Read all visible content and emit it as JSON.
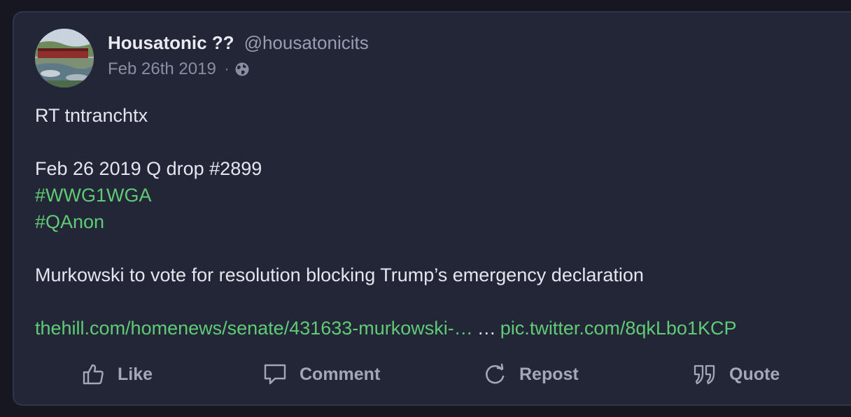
{
  "post": {
    "display_name": "Housatonic ??",
    "handle": "@housatonicits",
    "date": "Feb 26th 2019",
    "separator": "·",
    "visibility_icon": "globe-icon",
    "body": {
      "line1": "RT tntranchtx",
      "line2": "Feb 26 2019 Q drop #2899",
      "hashtag1": "#WWG1WGA",
      "hashtag2": "#QAnon",
      "line3": "Murkowski to vote for resolution blocking Trump’s emergency declaration",
      "link1": "thehill.com/homenews/senate/431633-murkowski-…",
      "ellipsis": "…",
      "link2": "pic.twitter.com/8qkLbo1KCP"
    }
  },
  "actions": {
    "like": {
      "label": "Like",
      "icon": "thumbs-up-icon"
    },
    "comment": {
      "label": "Comment",
      "icon": "comment-icon"
    },
    "repost": {
      "label": "Repost",
      "icon": "repost-icon"
    },
    "quote": {
      "label": "Quote",
      "icon": "quote-icon"
    }
  },
  "colors": {
    "background": "#16171f",
    "card": "#232637",
    "text": "#e4e5ee",
    "muted": "#8b8ea3",
    "link": "#5fcb75"
  }
}
